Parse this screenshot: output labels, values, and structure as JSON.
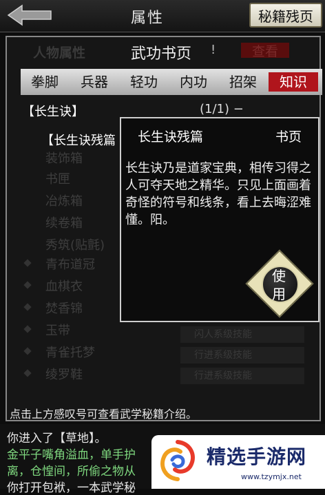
{
  "header": {
    "title": "属性",
    "secret_button": "秘籍残页"
  },
  "panel": {
    "title": "武功书页",
    "title_mark": "!",
    "background_labels": [
      "人物属性",
      "查看"
    ],
    "tabs": [
      {
        "label": "拳脚",
        "active": false
      },
      {
        "label": "兵器",
        "active": false
      },
      {
        "label": "轻功",
        "active": false
      },
      {
        "label": "内功",
        "active": false
      },
      {
        "label": "招架",
        "active": false
      },
      {
        "label": "知识",
        "active": true
      }
    ],
    "section": {
      "head": "【长生诀】",
      "count": "(1/1) −",
      "item": "【长生诀残篇"
    },
    "background_list": [
      "装饰箱",
      "书匣",
      "冶炼箱",
      "续卷箱",
      "秀筑(贴氈)",
      "青布道冠",
      "血棋衣",
      "焚香锦",
      "玉带",
      "青雀托梦",
      "绫罗鞋"
    ],
    "background_stats": [
      "闪人系级技能",
      "行进系级技能",
      "行进系级技能"
    ],
    "hint": "点击上方感叹号可查看武学秘籍介绍。"
  },
  "popup": {
    "name": "长生诀残篇",
    "type": "书页",
    "description": "长生诀乃是道家宝典，相传习得之人可夺天地之精华。只见上面画着奇怪的符号和线条，看上去晦涩难懂。阳。",
    "use_button": "使用"
  },
  "log": [
    {
      "text": "你进入了【草地】。",
      "color": "plain"
    },
    {
      "text": "金平子嘴角溢血，单手护",
      "color": "green"
    },
    {
      "text": "离，仓惶间，所偷之物从",
      "color": "green"
    },
    {
      "text": "你打开包袱，一本武学秘",
      "color": "plain"
    }
  ],
  "watermark": {
    "text": "精选手游网",
    "url": "www.tzymjx.net"
  },
  "colors": {
    "active_tab": "#b0151c",
    "log_green": "#7fd87f",
    "watermark_blue": "#1a2a6a"
  }
}
